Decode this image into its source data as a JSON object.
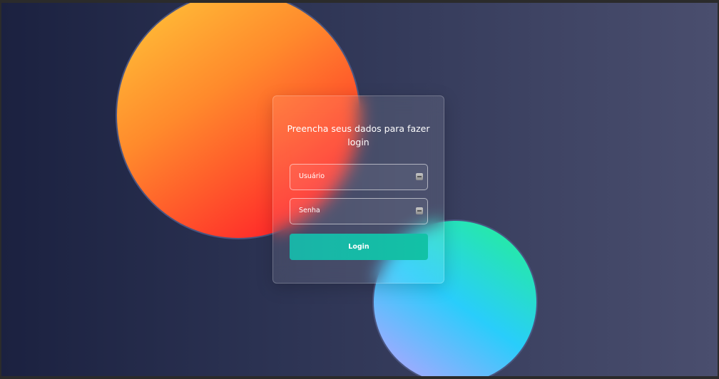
{
  "login": {
    "title": "Preencha seus dados para fazer login",
    "username_placeholder": "Usuário",
    "password_placeholder": "Senha",
    "submit_label": "Login"
  },
  "icons": {
    "username_field": "field-toggle-icon",
    "password_field": "field-toggle-icon"
  },
  "colors": {
    "background_start": "#1b2140",
    "background_end": "#4a4e6e",
    "orange_circle_top": "#ffc93a",
    "orange_circle_bottom": "#ff2a2a",
    "teal_circle_purple": "#c3a0ff",
    "teal_circle_cyan": "#29cdfb",
    "teal_circle_green": "#24f28d",
    "button": "#14bba6"
  }
}
